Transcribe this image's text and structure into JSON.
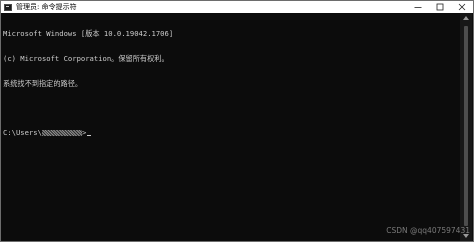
{
  "window": {
    "title": "管理员: 命令提示符",
    "controls": {
      "minimize_icon": "minimize-icon",
      "maximize_icon": "maximize-icon",
      "close_icon": "close-icon"
    }
  },
  "console": {
    "lines": [
      "Microsoft Windows [版本 10.0.19042.1706]",
      "(c) Microsoft Corporation。保留所有权利。",
      "系统找不到指定的路径。"
    ],
    "prompt_prefix": "C:\\Users\\",
    "prompt_suffix": ">"
  },
  "watermark": "CSDN @qq407597431",
  "colors": {
    "background": "#0c0c0c",
    "text": "#cccccc",
    "titlebar": "#ffffff"
  }
}
